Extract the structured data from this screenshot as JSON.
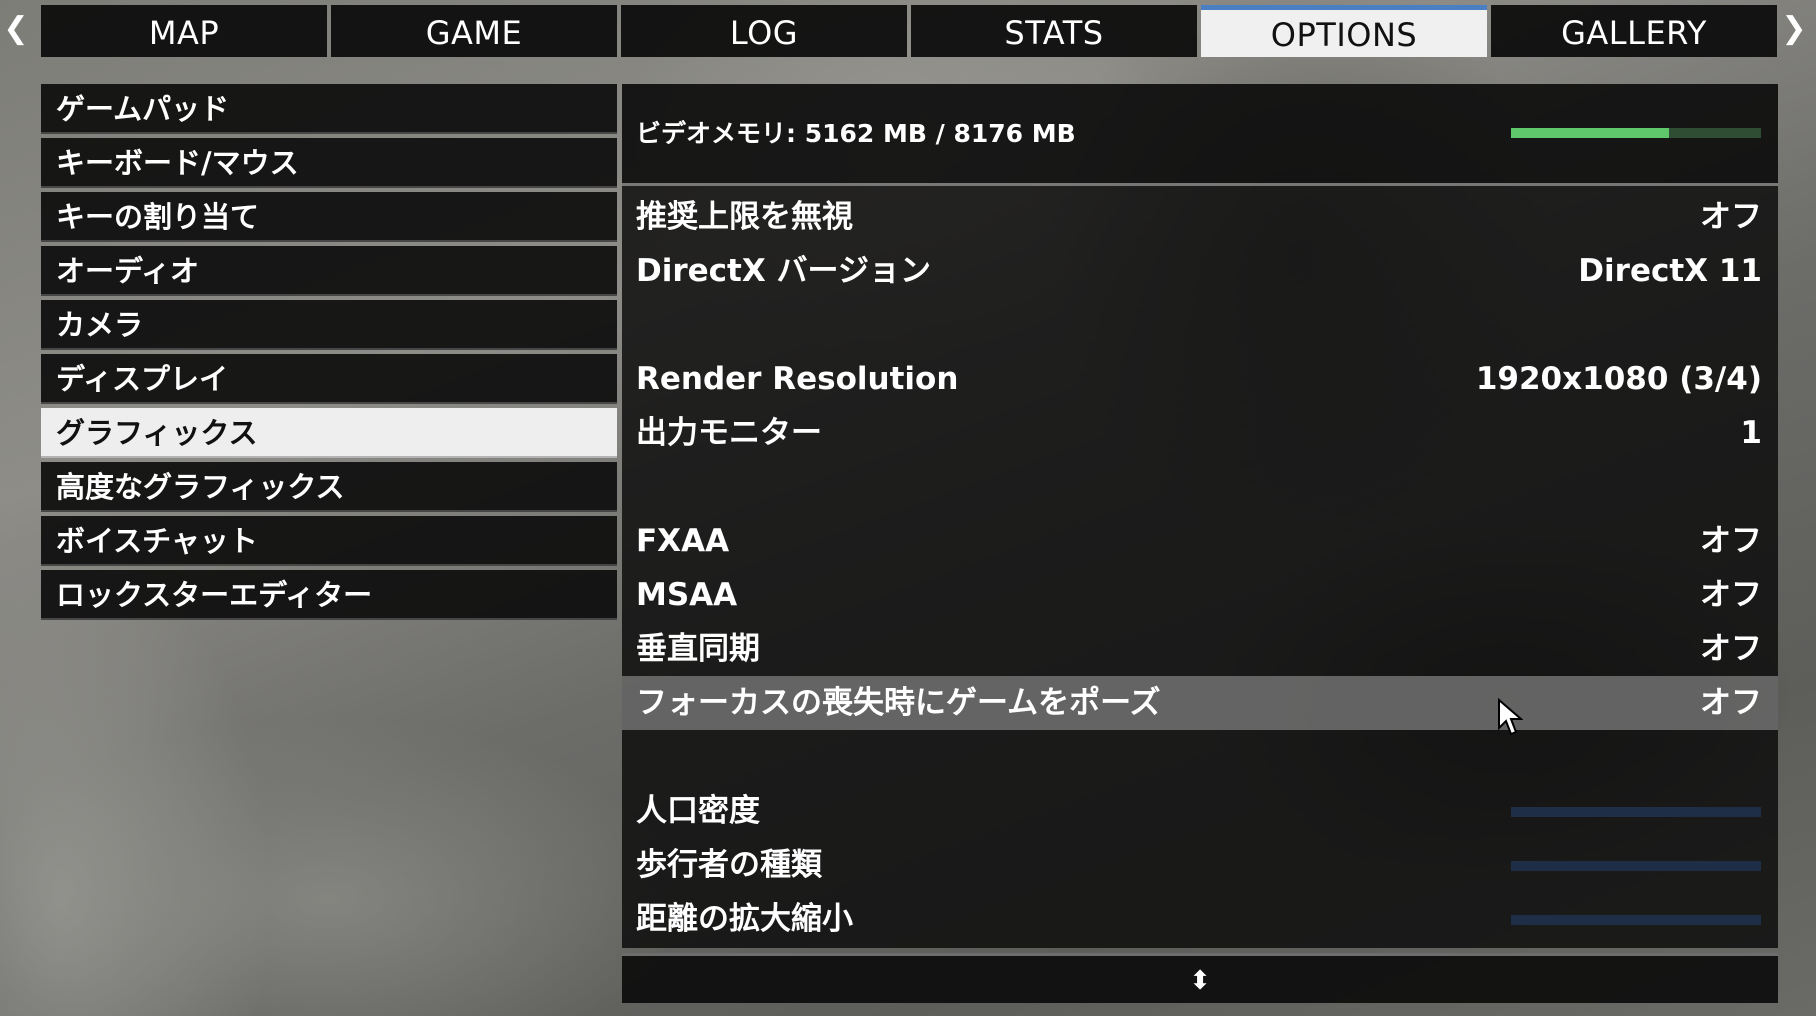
{
  "nav": {
    "prev_icon": "chevron-left-icon",
    "next_icon": "chevron-right-icon",
    "tabs": [
      {
        "label": "MAP"
      },
      {
        "label": "GAME"
      },
      {
        "label": "LOG"
      },
      {
        "label": "STATS"
      },
      {
        "label": "OPTIONS",
        "active": true
      },
      {
        "label": "GALLERY"
      }
    ]
  },
  "menu": {
    "items": [
      {
        "label": "ゲームパッド"
      },
      {
        "label": "キーボード/マウス"
      },
      {
        "label": "キーの割り当て"
      },
      {
        "label": "オーディオ"
      },
      {
        "label": "カメラ"
      },
      {
        "label": "ディスプレイ"
      },
      {
        "label": "グラフィックス",
        "active": true
      },
      {
        "label": "高度なグラフィックス"
      },
      {
        "label": "ボイスチャット"
      },
      {
        "label": "ロックスターエディター"
      }
    ]
  },
  "vram": {
    "label": "ビデオメモリ: 5162 MB / 8176 MB",
    "used_mb": 5162,
    "total_mb": 8176,
    "bar_color": "#5fc86a"
  },
  "settings": {
    "rows": [
      {
        "label": "推奨上限を無視",
        "value": "オフ"
      },
      {
        "label": "DirectX バージョン",
        "value": "DirectX 11"
      },
      {
        "label": "Render Resolution",
        "value": "1920x1080 (3/4)"
      },
      {
        "label": "出力モニター",
        "value": "1"
      },
      {
        "label": "FXAA",
        "value": "オフ"
      },
      {
        "label": "MSAA",
        "value": "オフ"
      },
      {
        "label": "垂直同期",
        "value": "オフ"
      },
      {
        "label": "フォーカスの喪失時にゲームをポーズ",
        "value": "オフ"
      },
      {
        "label": "人口密度"
      },
      {
        "label": "歩行者の種類"
      },
      {
        "label": "距離の拡大縮小"
      }
    ]
  },
  "footer": {
    "scroll_icon": "up-down-arrows-icon",
    "scroll_glyph": "⬍"
  }
}
